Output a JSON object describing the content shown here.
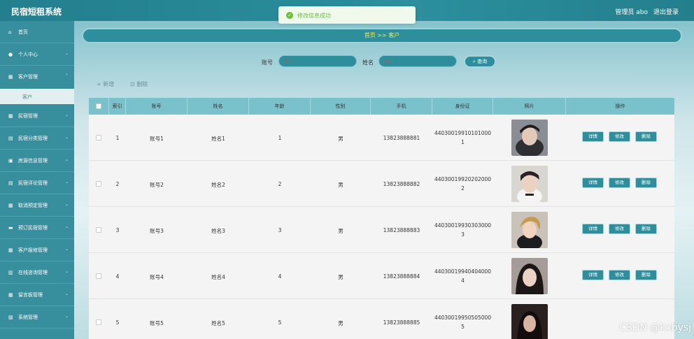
{
  "header": {
    "app_title": "民宿短租系统",
    "user_info": "管理员 abo",
    "logout": "退出登录"
  },
  "toast": {
    "message": "修改信息成功"
  },
  "sidebar": {
    "items": [
      {
        "label": "首页",
        "icon": "home-icon"
      },
      {
        "label": "个人中心",
        "icon": "user-icon"
      },
      {
        "label": "客户管理",
        "icon": "grid-icon"
      },
      {
        "label": "民宿管理",
        "icon": "grid-icon"
      },
      {
        "label": "民宿分类管理",
        "icon": "book-icon"
      },
      {
        "label": "房源信息管理",
        "icon": "lock-icon"
      },
      {
        "label": "民宿评论管理",
        "icon": "book-icon"
      },
      {
        "label": "取消预定管理",
        "icon": "grid-icon"
      },
      {
        "label": "预订民宿管理",
        "icon": "card-icon"
      },
      {
        "label": "客户报修管理",
        "icon": "grid-icon"
      },
      {
        "label": "在线咨询管理",
        "icon": "chart-icon"
      },
      {
        "label": "留言板管理",
        "icon": "grid-icon"
      },
      {
        "label": "系统管理",
        "icon": "trash-icon"
      }
    ],
    "sub_item": "客户"
  },
  "breadcrumb": "首页 >> 客户",
  "search": {
    "account_label": "账号",
    "account_placeholder": "账号",
    "name_label": "姓名",
    "name_placeholder": "姓名",
    "query_button": "查询"
  },
  "actions": {
    "add": "新增",
    "delete": "删除"
  },
  "table": {
    "headers": [
      "索引",
      "账号",
      "姓名",
      "年龄",
      "性别",
      "手机",
      "身份证",
      "照片",
      "操作"
    ],
    "rows": [
      {
        "index": "1",
        "account": "账号1",
        "name": "姓名1",
        "age": "1",
        "gender": "男",
        "phone": "13823888881",
        "id_line1": "44030019910101000",
        "id_line2": "1"
      },
      {
        "index": "2",
        "account": "账号2",
        "name": "姓名2",
        "age": "2",
        "gender": "男",
        "phone": "13823888882",
        "id_line1": "44030019920202000",
        "id_line2": "2"
      },
      {
        "index": "3",
        "account": "账号3",
        "name": "姓名3",
        "age": "3",
        "gender": "男",
        "phone": "13823888883",
        "id_line1": "44030019930303000",
        "id_line2": "3"
      },
      {
        "index": "4",
        "account": "账号4",
        "name": "姓名4",
        "age": "4",
        "gender": "男",
        "phone": "13823888884",
        "id_line1": "44030019940404000",
        "id_line2": "4"
      },
      {
        "index": "5",
        "account": "账号5",
        "name": "姓名5",
        "age": "5",
        "gender": "男",
        "phone": "13823888885",
        "id_line1": "44030019950505000",
        "id_line2": "5"
      }
    ],
    "ops": {
      "detail": "详情",
      "edit": "修改",
      "delete": "删除"
    }
  },
  "watermark": "CSDN @kxbysj"
}
